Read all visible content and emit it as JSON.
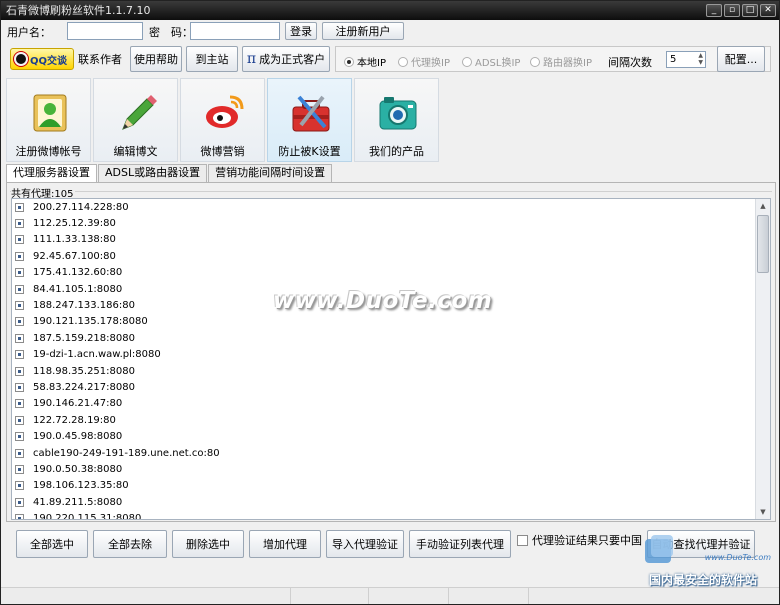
{
  "window": {
    "title": "石青微博刷粉丝软件1.1.7.10",
    "controls": [
      "minimize",
      "restore",
      "maximize",
      "close"
    ]
  },
  "login": {
    "username_label": "用户名：",
    "username_value": "",
    "password_label": "密　码：",
    "password_value": "",
    "login_button": "登录",
    "register_button": "注册新用户"
  },
  "toolbar": {
    "qq_button": "QQ交谈",
    "contact_author": "联系作者",
    "help": "使用帮助",
    "home": "到主站",
    "become_customer": "成为正式客户",
    "ip_modes": [
      {
        "label": "本地IP",
        "selected": true,
        "enabled": true
      },
      {
        "label": "代理换IP",
        "selected": false,
        "enabled": false
      },
      {
        "label": "ADSL换IP",
        "selected": false,
        "enabled": false
      },
      {
        "label": "路由器换IP",
        "selected": false,
        "enabled": false
      }
    ],
    "interval_label": "间隔次数",
    "interval_value": "5",
    "config_button": "配置..."
  },
  "features": [
    {
      "label": "注册微博帐号",
      "icon": "user-register-icon"
    },
    {
      "label": "编辑博文",
      "icon": "pencil-icon"
    },
    {
      "label": "微博营销",
      "icon": "weibo-logo-icon"
    },
    {
      "label": "防止被K设置",
      "icon": "toolbox-icon"
    },
    {
      "label": "我们的产品",
      "icon": "camera-icon"
    }
  ],
  "tabs": [
    {
      "label": "代理服务器设置",
      "active": true
    },
    {
      "label": "ADSL或路由器设置",
      "active": false
    },
    {
      "label": "营销功能间隔时间设置",
      "active": false
    }
  ],
  "proxy_panel": {
    "count_label": "共有代理:105",
    "proxies": [
      "200.27.114.228:80",
      "112.25.12.39:80",
      "111.1.33.138:80",
      "92.45.67.100:80",
      "175.41.132.60:80",
      "84.41.105.1:8080",
      "188.247.133.186:80",
      "190.121.135.178:8080",
      "187.5.159.218:8080",
      "19-dzi-1.acn.waw.pl:8080",
      "118.98.35.251:8080",
      "58.83.224.217:8080",
      "190.146.21.47:80",
      "122.72.28.19:80",
      "190.0.45.98:8080",
      "cable190-249-191-189.une.net.co:80",
      "190.0.50.38:8080",
      "198.106.123.35:80",
      "41.89.211.5:8080",
      "190.220.115.31:8080"
    ]
  },
  "actions": {
    "select_all": "全部选中",
    "deselect_all": "全部去除",
    "delete_selected": "删除选中",
    "add_proxy": "增加代理",
    "import_verify": "导入代理验证",
    "manual_verify": "手动验证列表代理",
    "china_only_label": "代理验证结果只要中国",
    "auto_find": "自动查找代理并验证"
  },
  "watermark": "www.DuoTe.com",
  "brand": {
    "url": "www.DuoTe.com",
    "slogan": "国内最安全的软件站"
  }
}
